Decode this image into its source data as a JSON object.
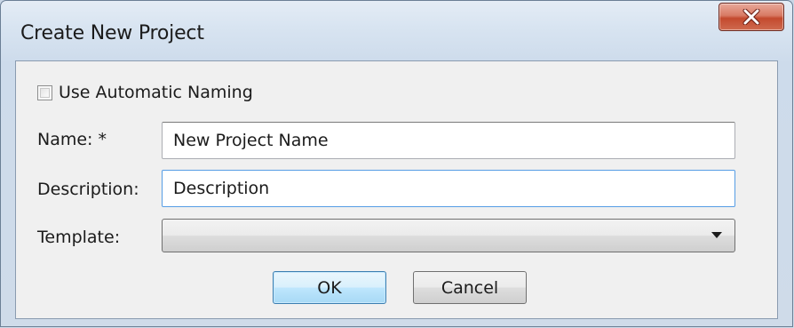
{
  "window": {
    "title": "Create New Project",
    "close_icon": "close-x-icon"
  },
  "form": {
    "auto_naming": {
      "label": "Use Automatic Naming",
      "checked": false
    },
    "name": {
      "label": "Name:  *",
      "value": "New Project Name"
    },
    "description": {
      "label": "Description:",
      "value": "Description"
    },
    "template": {
      "label": "Template:",
      "value": "",
      "dropdown_icon": "chevron-down-icon"
    }
  },
  "buttons": {
    "ok_label": "OK",
    "cancel_label": "Cancel"
  },
  "colors": {
    "close_button": "#c94a2f",
    "focus_border": "#569de5",
    "default_button": "#bee6fd"
  }
}
